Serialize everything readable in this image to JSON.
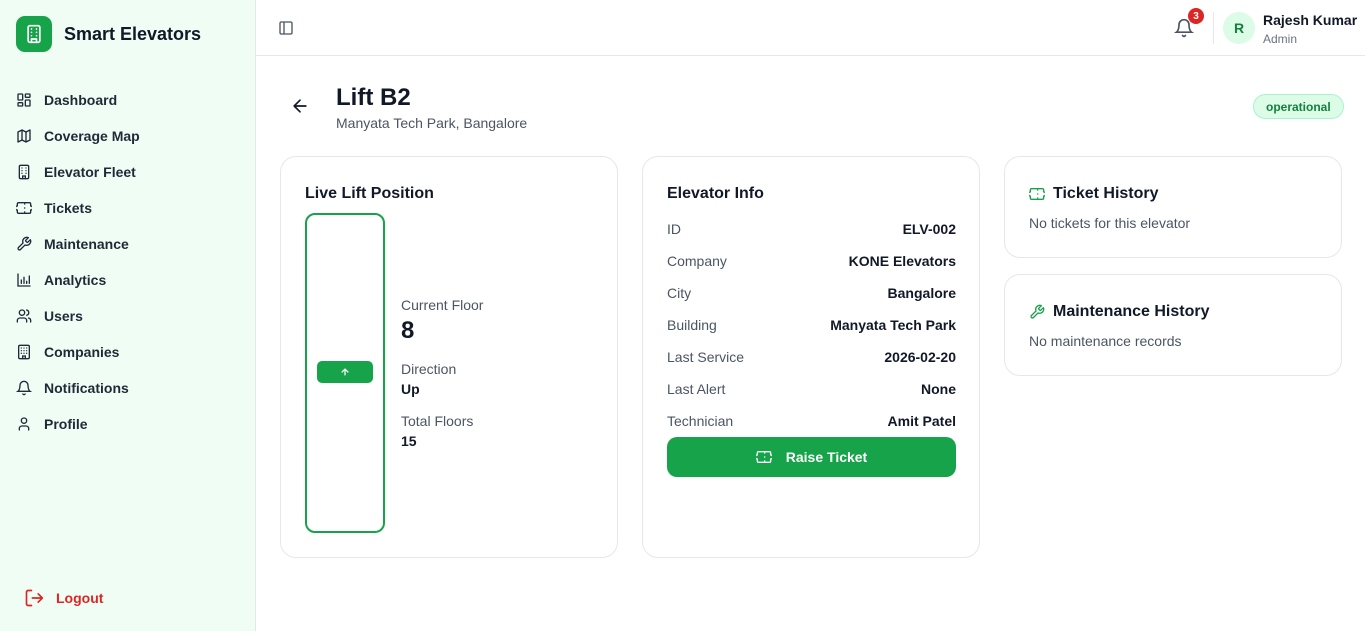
{
  "app": {
    "name": "Smart Elevators"
  },
  "sidebar": {
    "items": [
      {
        "label": "Dashboard",
        "icon": "dashboard-icon"
      },
      {
        "label": "Coverage Map",
        "icon": "map-icon"
      },
      {
        "label": "Elevator Fleet",
        "icon": "building-icon"
      },
      {
        "label": "Tickets",
        "icon": "ticket-icon"
      },
      {
        "label": "Maintenance",
        "icon": "wrench-icon"
      },
      {
        "label": "Analytics",
        "icon": "bar-chart-icon"
      },
      {
        "label": "Users",
        "icon": "users-icon"
      },
      {
        "label": "Companies",
        "icon": "office-icon"
      },
      {
        "label": "Notifications",
        "icon": "bell-icon"
      },
      {
        "label": "Profile",
        "icon": "user-icon"
      }
    ],
    "logout_label": "Logout"
  },
  "header": {
    "notification_count": "3",
    "user": {
      "initial": "R",
      "name": "Rajesh Kumar",
      "role": "Admin"
    }
  },
  "page": {
    "title": "Lift B2",
    "subtitle": "Manyata Tech Park, Bangalore",
    "status": "operational"
  },
  "live": {
    "title": "Live Lift Position",
    "current_floor_label": "Current Floor",
    "current_floor": "8",
    "direction_label": "Direction",
    "direction": "Up",
    "total_floors_label": "Total Floors",
    "total_floors": "15"
  },
  "info": {
    "title": "Elevator Info",
    "rows": [
      {
        "label": "ID",
        "value": "ELV-002"
      },
      {
        "label": "Company",
        "value": "KONE Elevators"
      },
      {
        "label": "City",
        "value": "Bangalore"
      },
      {
        "label": "Building",
        "value": "Manyata Tech Park"
      },
      {
        "label": "Last Service",
        "value": "2026-02-20"
      },
      {
        "label": "Last Alert",
        "value": "None"
      },
      {
        "label": "Technician",
        "value": "Amit Patel"
      }
    ],
    "raise_ticket_label": "Raise Ticket"
  },
  "ticket_history": {
    "title": "Ticket History",
    "empty": "No tickets for this elevator"
  },
  "maintenance_history": {
    "title": "Maintenance History",
    "empty": "No maintenance records"
  },
  "colors": {
    "accent": "#16a34a",
    "accent_light": "#dcfce7",
    "sidebar_bg": "#f0fdf4",
    "danger": "#dc2626"
  }
}
